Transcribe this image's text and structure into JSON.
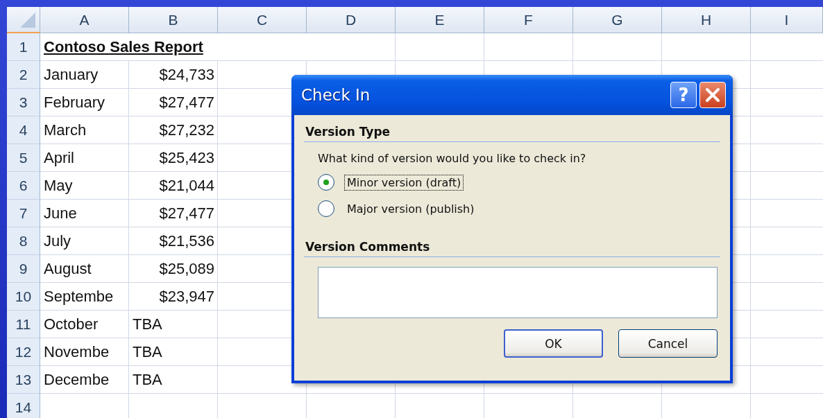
{
  "sheet": {
    "columns": [
      "A",
      "B",
      "C",
      "D",
      "E",
      "F",
      "G",
      "H",
      "I"
    ],
    "rows": [
      {
        "number": "1",
        "cells": [
          {
            "text": "Contoso Sales Report",
            "kind": "title"
          }
        ]
      },
      {
        "number": "2",
        "cells": [
          {
            "text": "January",
            "kind": "text"
          },
          {
            "text": "$24,733",
            "kind": "number"
          }
        ]
      },
      {
        "number": "3",
        "cells": [
          {
            "text": "February",
            "kind": "text"
          },
          {
            "text": "$27,477",
            "kind": "number"
          }
        ]
      },
      {
        "number": "4",
        "cells": [
          {
            "text": "March",
            "kind": "text"
          },
          {
            "text": "$27,232",
            "kind": "number"
          }
        ]
      },
      {
        "number": "5",
        "cells": [
          {
            "text": "April",
            "kind": "text"
          },
          {
            "text": "$25,423",
            "kind": "number"
          }
        ]
      },
      {
        "number": "6",
        "cells": [
          {
            "text": "May",
            "kind": "text"
          },
          {
            "text": "$21,044",
            "kind": "number"
          }
        ]
      },
      {
        "number": "7",
        "cells": [
          {
            "text": "June",
            "kind": "text"
          },
          {
            "text": "$27,477",
            "kind": "number"
          }
        ]
      },
      {
        "number": "8",
        "cells": [
          {
            "text": "July",
            "kind": "text"
          },
          {
            "text": "$21,536",
            "kind": "number"
          }
        ]
      },
      {
        "number": "9",
        "cells": [
          {
            "text": "August",
            "kind": "text"
          },
          {
            "text": "$25,089",
            "kind": "number"
          }
        ]
      },
      {
        "number": "10",
        "cells": [
          {
            "text": "Septembe",
            "kind": "text"
          },
          {
            "text": "$23,947",
            "kind": "number"
          }
        ]
      },
      {
        "number": "11",
        "cells": [
          {
            "text": "October",
            "kind": "text"
          },
          {
            "text": "TBA",
            "kind": "text"
          }
        ]
      },
      {
        "number": "12",
        "cells": [
          {
            "text": "Novembe",
            "kind": "text"
          },
          {
            "text": "TBA",
            "kind": "text"
          }
        ]
      },
      {
        "number": "13",
        "cells": [
          {
            "text": "Decembe",
            "kind": "text"
          },
          {
            "text": "TBA",
            "kind": "text"
          }
        ]
      },
      {
        "number": "14"
      }
    ]
  },
  "dialog": {
    "title": "Check In",
    "help_button": "?",
    "version_type": {
      "heading": "Version Type",
      "question": "What kind of version would you like to check in?",
      "options": [
        {
          "label": "Minor version (draft)",
          "selected": true,
          "focused": true
        },
        {
          "label": "Major version (publish)",
          "selected": false,
          "focused": false
        }
      ]
    },
    "version_comments": {
      "heading": "Version Comments"
    },
    "buttons": [
      {
        "label": "OK",
        "default": true
      },
      {
        "label": "Cancel",
        "default": false
      }
    ]
  }
}
